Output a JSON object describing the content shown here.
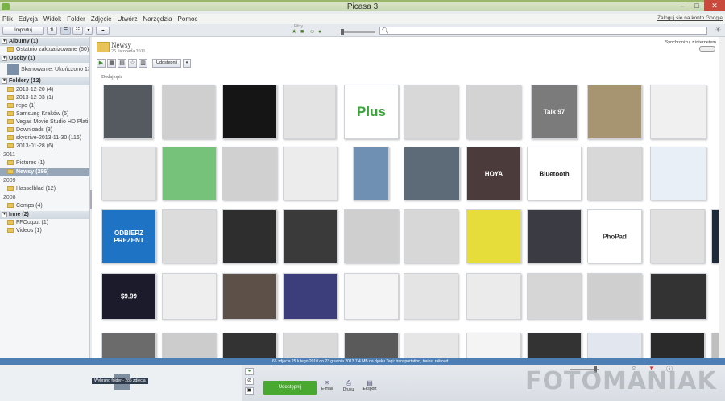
{
  "window": {
    "title": "Picasa 3",
    "sign_in": "Zaloguj się na konto Google"
  },
  "menu": [
    "Plik",
    "Edycja",
    "Widok",
    "Folder",
    "Zdjęcie",
    "Utwórz",
    "Narzędzia",
    "Pomoc"
  ],
  "toolbar": {
    "import_label": "Importuj",
    "filters_label": "Filtry",
    "search_placeholder": ""
  },
  "sidebar": {
    "items": [
      {
        "kind": "head",
        "label": "Albumy (1)"
      },
      {
        "kind": "item",
        "label": "Ostatnio zaktualizowane (60)"
      },
      {
        "kind": "head",
        "label": "Osoby (1)"
      },
      {
        "kind": "person",
        "label": "Skanowanie. Ukończono 13%"
      },
      {
        "kind": "head",
        "label": "Foldery (12)"
      },
      {
        "kind": "item",
        "label": "2013-12-20 (4)"
      },
      {
        "kind": "item",
        "label": "2013-12-03 (1)"
      },
      {
        "kind": "item",
        "label": "repo (1)"
      },
      {
        "kind": "item",
        "label": "Samsung Kraków (5)"
      },
      {
        "kind": "item",
        "label": "Vegas Movie Studio HD Platinum..."
      },
      {
        "kind": "item",
        "label": "Downloads (3)"
      },
      {
        "kind": "item",
        "label": "skydrive-2013-11-30 (116)"
      },
      {
        "kind": "item",
        "label": "2013-01-28 (6)"
      },
      {
        "kind": "year",
        "label": "2011"
      },
      {
        "kind": "item",
        "label": "Pictures (1)"
      },
      {
        "kind": "selected",
        "label": "Newsy (286)"
      },
      {
        "kind": "year",
        "label": "2009"
      },
      {
        "kind": "item",
        "label": "Hasselblad (12)"
      },
      {
        "kind": "year",
        "label": "2008"
      },
      {
        "kind": "item",
        "label": "Comps (4)"
      },
      {
        "kind": "head",
        "label": "Inne (2)"
      },
      {
        "kind": "item",
        "label": "FFOutput (1)"
      },
      {
        "kind": "item",
        "label": "Videos (1)"
      }
    ]
  },
  "album": {
    "title": "Newsy",
    "date": "25 listopada 2011",
    "sync_label": "Synchronizuj z internetem",
    "share_label": "Udostępnij",
    "add_caption": "Dodaj opis"
  },
  "thumbnails": {
    "rows": [
      [
        {
          "name": "dark-card",
          "bg": "#555a60",
          "text": ""
        },
        {
          "name": "sony-camera",
          "bg": "#cfcfcf",
          "text": ""
        },
        {
          "name": "dark-screen",
          "bg": "#151515",
          "text": ""
        },
        {
          "name": "usb-device",
          "bg": "#e3e3e3",
          "text": ""
        },
        {
          "name": "plus-logo",
          "bg": "#ffffff",
          "text": "Plus"
        },
        {
          "name": "silver-coins",
          "bg": "#d8d8d8",
          "text": ""
        },
        {
          "name": "silver-coins-2",
          "bg": "#d3d3d3",
          "text": ""
        },
        {
          "name": "talk97-phone",
          "bg": "#7b7b7b",
          "text": "Talk 97"
        },
        {
          "name": "gold-phone",
          "bg": "#a79572",
          "text": ""
        },
        {
          "name": "building-sketch",
          "bg": "#f0f0f0",
          "text": ""
        }
      ],
      [
        {
          "name": "tablet",
          "bg": "#e6e6e6",
          "text": ""
        },
        {
          "name": "yellow-device",
          "bg": "#76c27a",
          "text": ""
        },
        {
          "name": "laptop-screen",
          "bg": "#d0d0d0",
          "text": ""
        },
        {
          "name": "canon-camera",
          "bg": "#ececec",
          "text": ""
        },
        {
          "name": "tall-building",
          "bg": "#6f8fb3",
          "text": ""
        },
        {
          "name": "crowd",
          "bg": "#5d6a78",
          "text": ""
        },
        {
          "name": "hoya-filter",
          "bg": "#4b3b3b",
          "text": "HOYA"
        },
        {
          "name": "bluetooth-logo",
          "bg": "#ffffff",
          "text": "Bluetooth"
        },
        {
          "name": "red-car-screen",
          "bg": "#d8d8d8",
          "text": ""
        },
        {
          "name": "blue-banner",
          "bg": "#e9eff6",
          "text": ""
        }
      ],
      [
        {
          "name": "fujifilm-promo",
          "bg": "#1f73c4",
          "text": "ODBIERZ PREZENT"
        },
        {
          "name": "lens",
          "bg": "#dcdcdc",
          "text": ""
        },
        {
          "name": "software-ui",
          "bg": "#2e2e2e",
          "text": ""
        },
        {
          "name": "dark-ui",
          "bg": "#3a3a3a",
          "text": ""
        },
        {
          "name": "drawing-tablet",
          "bg": "#cfcfcf",
          "text": ""
        },
        {
          "name": "nikon-camera",
          "bg": "#d7d7d7",
          "text": ""
        },
        {
          "name": "yellow-phone",
          "bg": "#e6dc3a",
          "text": ""
        },
        {
          "name": "colorful-phones",
          "bg": "#3b3b44",
          "text": ""
        },
        {
          "name": "phopad-text",
          "bg": "#ffffff",
          "text": "PhoPad"
        },
        {
          "name": "white-phone",
          "bg": "#e0e0e0",
          "text": ""
        },
        {
          "name": "dark-landscape",
          "bg": "#1d2a3a",
          "text": ""
        }
      ],
      [
        {
          "name": "adobe-price",
          "bg": "#1b1b2b",
          "text": "$9.99"
        },
        {
          "name": "monitor-stand",
          "bg": "#eeeeee",
          "text": ""
        },
        {
          "name": "people-group",
          "bg": "#5d5048",
          "text": ""
        },
        {
          "name": "stage-crowd",
          "bg": "#3b3e7a",
          "text": ""
        },
        {
          "name": "imac",
          "bg": "#f4f4f4",
          "text": ""
        },
        {
          "name": "cable-gadget",
          "bg": "#e4e4e4",
          "text": ""
        },
        {
          "name": "book-laptop",
          "bg": "#ebebeb",
          "text": ""
        },
        {
          "name": "fuji-camera",
          "bg": "#d6d6d6",
          "text": ""
        },
        {
          "name": "cinema-camera",
          "bg": "#cfcfcf",
          "text": ""
        },
        {
          "name": "software-window",
          "bg": "#333333",
          "text": ""
        }
      ],
      [
        {
          "name": "partial-1",
          "bg": "#6b6b6b",
          "text": ""
        },
        {
          "name": "partial-2",
          "bg": "#cccccc",
          "text": ""
        },
        {
          "name": "partial-3",
          "bg": "#333333",
          "text": ""
        },
        {
          "name": "partial-4",
          "bg": "#d9d9d9",
          "text": ""
        },
        {
          "name": "partial-5",
          "bg": "#5a5a5a",
          "text": ""
        },
        {
          "name": "partial-6",
          "bg": "#e6e6e6",
          "text": ""
        },
        {
          "name": "partial-7",
          "bg": "#f4f4f4",
          "text": ""
        },
        {
          "name": "partial-8",
          "bg": "#333333",
          "text": ""
        },
        {
          "name": "partial-9",
          "bg": "#e2e6ee",
          "text": ""
        },
        {
          "name": "partial-10",
          "bg": "#2a2a2a",
          "text": ""
        },
        {
          "name": "partial-11",
          "bg": "#bfbfbf",
          "text": ""
        },
        {
          "name": "partial-12",
          "bg": "#444444",
          "text": ""
        }
      ]
    ]
  },
  "status": {
    "text": "65 zdjęcia     25 lutego 2010 do 23 grudnia 2013     7,4 MB na dysku     Tagi: transportation, trains, railroad"
  },
  "tray": {
    "selected_label": "Wybrano folder - 286 zdjęcia",
    "share_label": "Udostępnij",
    "email_label": "E-mail",
    "print_label": "Drukuj",
    "export_label": "Eksport"
  },
  "watermark": "FOTOMANIAK",
  "colors": {
    "status_bar": "#4d7fb5",
    "share_button": "#48a82f",
    "title_accent": "#9bb56a"
  }
}
